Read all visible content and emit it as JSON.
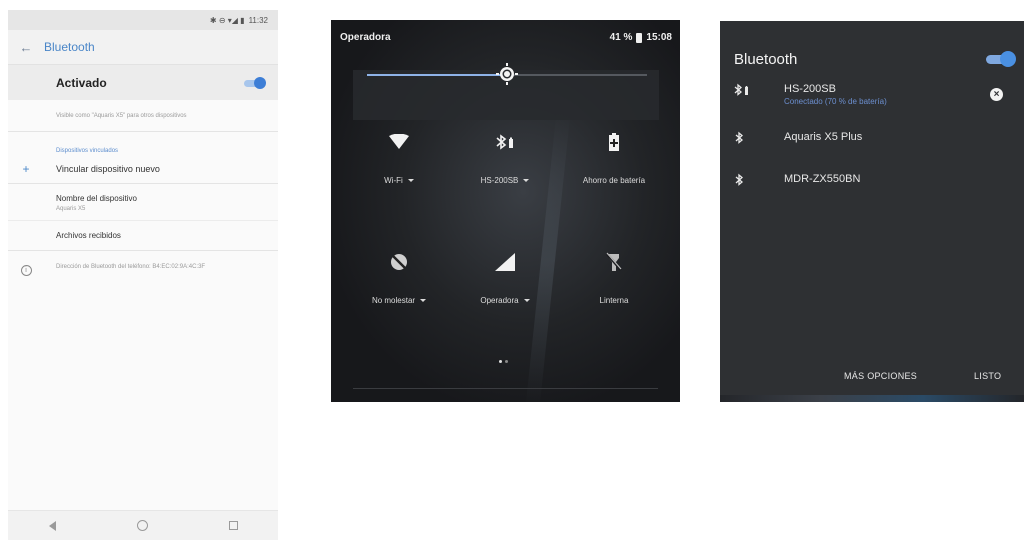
{
  "settings_screen": {
    "status_bar": {
      "icons": "✱ ⊖ ▾◢ ▮",
      "time": "11:32"
    },
    "toolbar": {
      "title": "Bluetooth"
    },
    "master_switch": {
      "label": "Activado",
      "on": true
    },
    "visibility_text": "Visible como \"Aquaris X5\" para otros dispositivos",
    "section_header": "Dispositivos vinculados",
    "pair_new": {
      "icon": "plus-icon",
      "label": "Vincular dispositivo nuevo"
    },
    "device_name": {
      "title": "Nombre del dispositivo",
      "value": "Aquaris X5"
    },
    "received_files": "Archivos recibidos",
    "bt_address": "Dirección de Bluetooth del teléfono: B4:EC:02:9A:4C:3F"
  },
  "quick_settings": {
    "carrier": "Operadora",
    "battery_percent": "41 %",
    "time": "15:08",
    "brightness_fraction": 0.5,
    "tiles": [
      {
        "icon": "wifi-icon",
        "label": "Wi-Fi",
        "has_caret": true
      },
      {
        "icon": "bluetooth-battery-icon",
        "label": "HS-200SB",
        "has_caret": true
      },
      {
        "icon": "battery-saver-icon",
        "label": "Ahorro de batería",
        "has_caret": false
      },
      {
        "icon": "do-not-disturb-icon",
        "label": "No molestar",
        "has_caret": true
      },
      {
        "icon": "signal-icon",
        "label": "Operadora",
        "has_caret": true
      },
      {
        "icon": "flashlight-off-icon",
        "label": "Linterna",
        "has_caret": false
      }
    ],
    "page_indicator": {
      "pages": 2,
      "current": 0
    }
  },
  "bluetooth_dialog": {
    "title": "Bluetooth",
    "enabled": true,
    "devices": [
      {
        "name": "HS-200SB",
        "status": "Conectado (70 % de batería)",
        "icon": "bluetooth-battery-icon",
        "connected": true
      },
      {
        "name": "Aquaris X5 Plus",
        "status": "",
        "icon": "bluetooth-icon",
        "connected": false
      },
      {
        "name": "MDR-ZX550BN",
        "status": "",
        "icon": "bluetooth-icon",
        "connected": false
      }
    ],
    "more_options_label": "MÁS OPCIONES",
    "done_label": "LISTO"
  },
  "colors": {
    "accent_light": "#4a86c8",
    "accent_dark": "#4a90e2",
    "dark_panel": "#2e3033",
    "connected_text": "#6c8fd0"
  }
}
